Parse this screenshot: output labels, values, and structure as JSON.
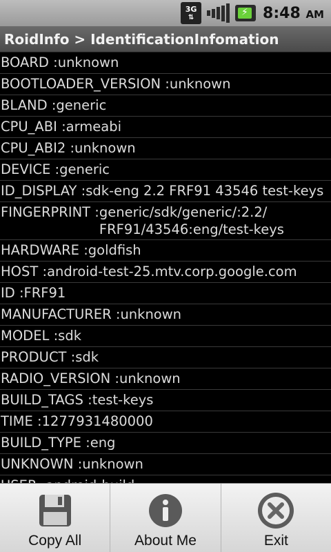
{
  "status_bar": {
    "network_label": "3G",
    "time": "8:48",
    "ampm": "AM",
    "battery_color": "#6ad13a"
  },
  "title": "RoidInfo > IdentificationInfomation",
  "rows": [
    {
      "key": "BOARD :",
      "value": "unknown"
    },
    {
      "key": "BOOTLOADER_VERSION :",
      "value": "unknown"
    },
    {
      "key": "BLAND :",
      "value": "generic"
    },
    {
      "key": "CPU_ABI :",
      "value": "armeabi"
    },
    {
      "key": "CPU_ABI2 :",
      "value": "unknown"
    },
    {
      "key": "DEVICE :",
      "value": "generic"
    },
    {
      "key": "ID_DISPLAY :",
      "value": "sdk-eng 2.2 FRF91 43546 test-keys"
    },
    {
      "key": "FINGERPRINT :",
      "value": "generic/sdk/generic/:2.2/\nFRF91/43546:eng/test-keys"
    },
    {
      "key": "HARDWARE :",
      "value": "goldfish"
    },
    {
      "key": "HOST :",
      "value": "android-test-25.mtv.corp.google.com"
    },
    {
      "key": "ID :",
      "value": "FRF91"
    },
    {
      "key": "MANUFACTURER :",
      "value": "unknown"
    },
    {
      "key": "MODEL :",
      "value": "sdk"
    },
    {
      "key": "PRODUCT :",
      "value": "sdk"
    },
    {
      "key": "RADIO_VERSION :",
      "value": "unknown"
    },
    {
      "key": "BUILD_TAGS :",
      "value": "test-keys"
    },
    {
      "key": "TIME :",
      "value": "1277931480000"
    },
    {
      "key": "BUILD_TYPE :",
      "value": "eng"
    },
    {
      "key": "UNKNOWN :",
      "value": "unknown"
    },
    {
      "key": "USER :",
      "value": "android-build"
    }
  ],
  "menu": {
    "items": [
      {
        "label": "Copy All",
        "icon": "save-icon"
      },
      {
        "label": "About Me",
        "icon": "info-icon"
      },
      {
        "label": "Exit",
        "icon": "close-icon"
      }
    ]
  }
}
